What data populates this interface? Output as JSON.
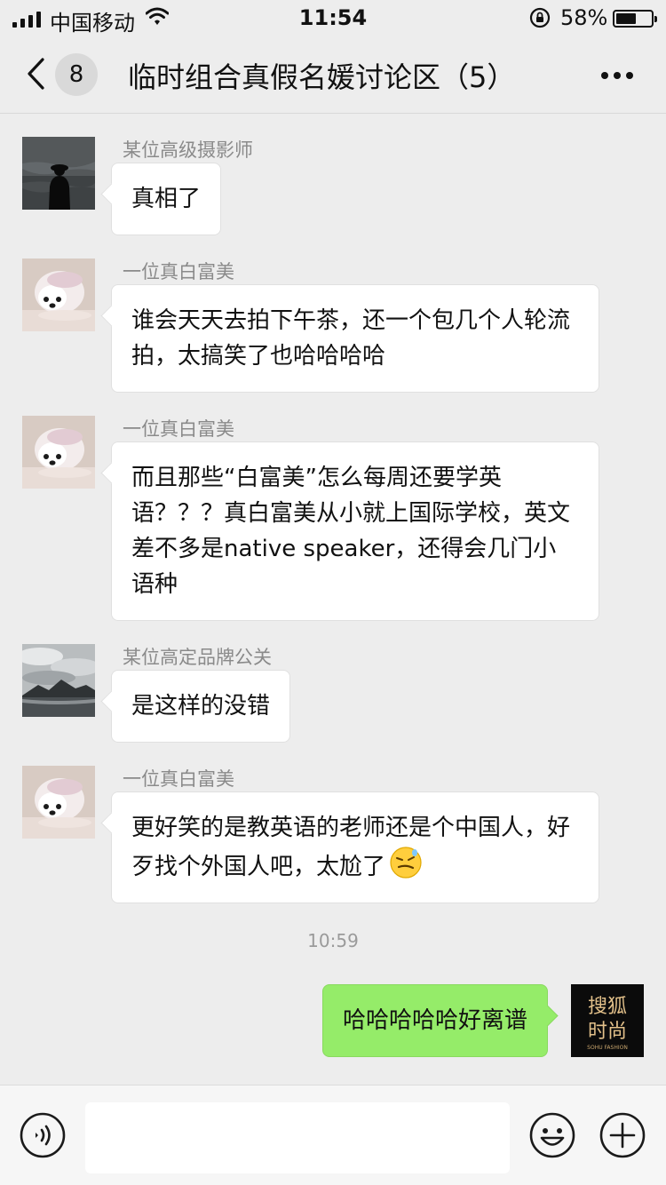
{
  "status_bar": {
    "carrier": "中国移动",
    "time": "11:54",
    "battery_percent": "58%",
    "battery_level": 0.58
  },
  "nav": {
    "unread_count": "8",
    "title": "临时组合真假名媛讨论区（5）"
  },
  "messages": [
    {
      "sender": "某位高级摄影师",
      "text": "真相了"
    },
    {
      "sender": "一位真白富美",
      "text": "谁会天天去拍下午茶，还一个包几个人轮流拍，太搞笑了也哈哈哈哈"
    },
    {
      "sender": "一位真白富美",
      "text": "而且那些“白富美”怎么每周还要学英语？？？真白富美从小就上国际学校，英文差不多是native speaker，还得会几门小语种"
    },
    {
      "sender": "某位高定品牌公关",
      "text": "是这样的没错"
    },
    {
      "sender": "一位真白富美",
      "text": "更好笑的是教英语的老师还是个中国人，好歹找个外国人吧，太尬了"
    }
  ],
  "time_separator": "10:59",
  "my_message": {
    "text": "哈哈哈哈哈好离谱"
  },
  "my_avatar": {
    "line1": "搜狐",
    "line2": "时尚",
    "subline": "SOHU FASHION"
  },
  "colors": {
    "background": "#ededed",
    "my_bubble": "#95ec69",
    "their_bubble": "#ffffff"
  },
  "icons": {
    "back": "chevron-left-icon",
    "more": "more-dots-icon",
    "voice": "voice-icon",
    "emoji": "emoji-icon",
    "plus": "plus-icon"
  }
}
